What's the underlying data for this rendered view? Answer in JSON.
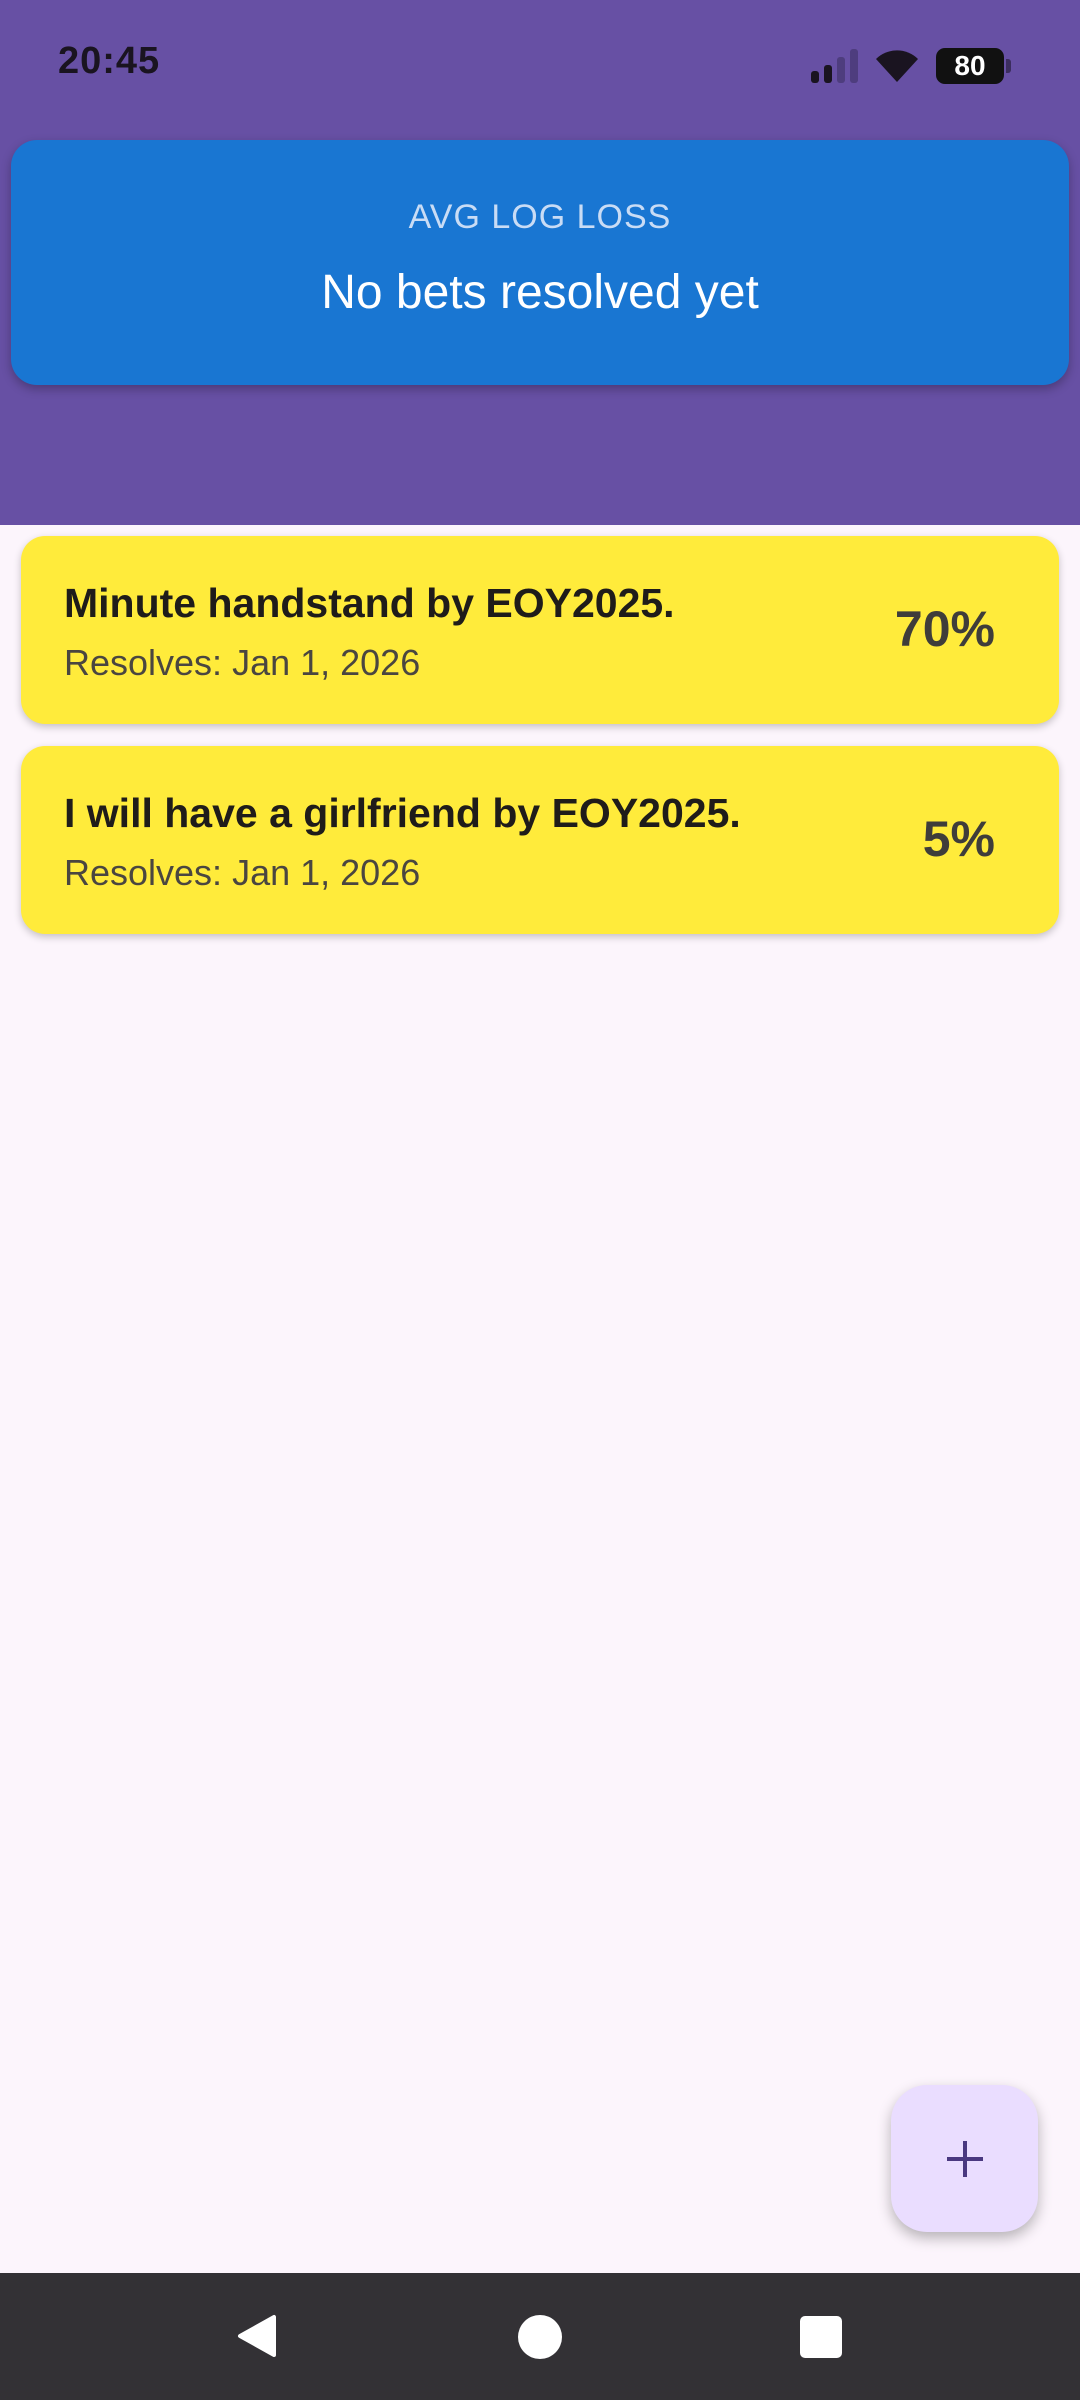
{
  "status_bar": {
    "time": "20:45",
    "battery_level": "80",
    "icons": [
      "signal-icon",
      "wifi-icon",
      "battery-icon"
    ]
  },
  "summary": {
    "label": "AVG LOG LOSS",
    "value": "No bets resolved yet"
  },
  "bets": [
    {
      "title": "Minute handstand by EOY2025.",
      "resolves": "Resolves: Jan 1, 2026",
      "probability": "70%"
    },
    {
      "title": "I will have a girlfriend by EOY2025.",
      "resolves": "Resolves: Jan 1, 2026",
      "probability": "5%"
    }
  ],
  "fab": {
    "icon": "plus-icon"
  },
  "nav": {
    "icons": [
      "back-icon",
      "home-icon",
      "recents-icon"
    ]
  },
  "colors": {
    "header": "#6750a4",
    "summary_card": "#1976d2",
    "bet_card": "#ffeb3b",
    "fab": "#eaddff",
    "background": "#fcf5fc",
    "nav_bar": "#333135"
  }
}
